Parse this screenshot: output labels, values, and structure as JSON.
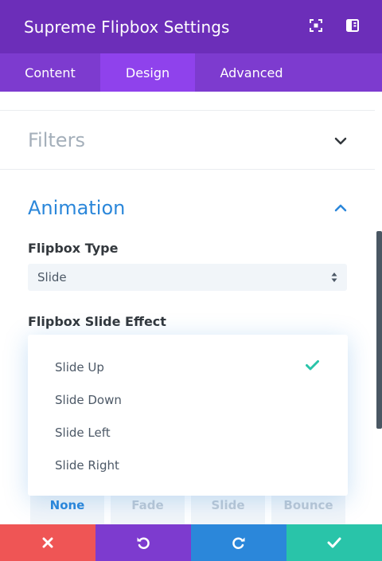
{
  "header": {
    "title": "Supreme Flipbox Settings"
  },
  "tabs": [
    {
      "label": "Content"
    },
    {
      "label": "Design"
    },
    {
      "label": "Advanced"
    }
  ],
  "sections": {
    "filters": {
      "title": "Filters"
    },
    "animation": {
      "title": "Animation"
    }
  },
  "fields": {
    "flipbox_type": {
      "label": "Flipbox Type",
      "value": "Slide"
    },
    "flipbox_slide_effect": {
      "label": "Flipbox Slide Effect",
      "options": [
        "Slide Up",
        "Slide Down",
        "Slide Left",
        "Slide Right"
      ],
      "selected": "Slide Up"
    }
  },
  "presets": [
    "None",
    "Fade",
    "Slide",
    "Bounce"
  ],
  "icons": {
    "header": [
      "focus-icon",
      "sidebar-icon"
    ],
    "footer": [
      "close-icon",
      "undo-icon",
      "redo-icon",
      "check-icon"
    ]
  },
  "colors": {
    "header_bg": "#6c2eb9",
    "tab_bar_bg": "#7d3bcf",
    "active_tab_bg": "#8f42ec",
    "accent_blue": "#2b87da",
    "check_green": "#29c4a9",
    "cancel_red": "#ef5555"
  }
}
